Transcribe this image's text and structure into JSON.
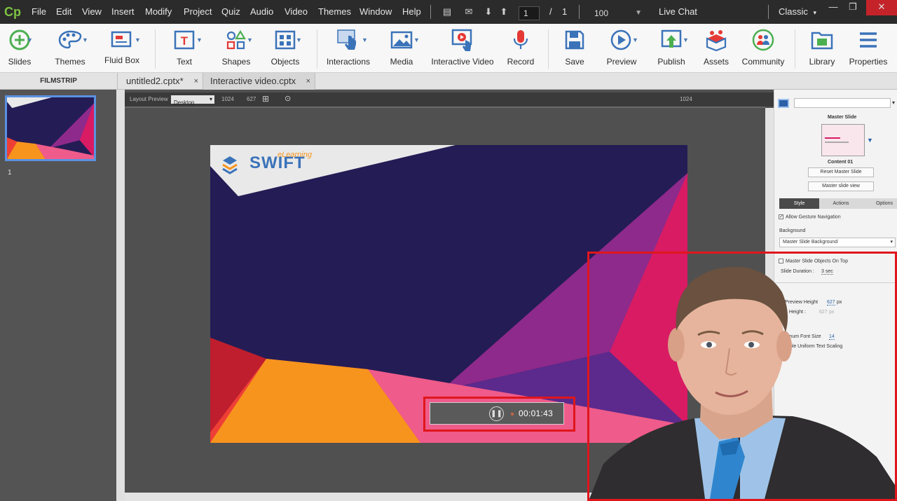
{
  "app": {
    "logo": "Cp",
    "mode": "Classic",
    "live_chat": "Live Chat"
  },
  "menu": [
    "File",
    "Edit",
    "View",
    "Insert",
    "Modify",
    "Project",
    "Quiz",
    "Audio",
    "Video",
    "Themes",
    "Window",
    "Help"
  ],
  "nav": {
    "slide_current": "1",
    "slide_separator": "/",
    "slide_total": "1",
    "zoom": "100"
  },
  "toolbar": {
    "slides": "Slides",
    "themes": "Themes",
    "fluid_box": "Fluid Box",
    "text": "Text",
    "shapes": "Shapes",
    "objects": "Objects",
    "interactions": "Interactions",
    "media": "Media",
    "interactive_video": "Interactive Video",
    "record": "Record",
    "save": "Save",
    "preview": "Preview",
    "publish": "Publish",
    "assets": "Assets",
    "community": "Community",
    "library": "Library",
    "properties": "Properties"
  },
  "tabs": {
    "filmstrip_title": "FILMSTRIP",
    "documents": [
      {
        "label": "untitled2.cptx*",
        "close": "×"
      },
      {
        "label": "Interactive video.cptx",
        "close": "×"
      }
    ]
  },
  "filmstrip": {
    "slide_number": "1"
  },
  "stage": {
    "layout_preview": "Layout Preview",
    "device": "Desktop",
    "width": "1024",
    "height": "627",
    "ruler_end": "1024"
  },
  "slide": {
    "brand_script": "eLearning",
    "brand_name": "SWIFT",
    "timer": "00:01:43",
    "colors": {
      "navy": "#241c55",
      "purple": "#8e2a8b",
      "magenta": "#d81b63",
      "orange": "#f7941d",
      "red": "#ee3f36",
      "pink": "#ef5b8a"
    }
  },
  "properties": {
    "master_slide_title": "Master Slide",
    "master_name": "Content 01",
    "reset_master": "Reset Master Slide",
    "master_view": "Master slide view",
    "tabs": [
      "Style",
      "Actions",
      "Options"
    ],
    "allow_gesture": "Allow Gesture Navigation",
    "background_label": "Background",
    "background_value": "Master Slide Background",
    "objects_on_top": "Master Slide Objects On Top",
    "slide_duration_label": "Slide Duration :",
    "slide_duration_value": "3 sec",
    "preview_height_label": "Preview Height",
    "preview_height_value": "627",
    "preview_height_unit": "px",
    "height_label": "n Height :",
    "height_value": "627",
    "height_unit": "px",
    "min_font_label": "imum Font Size",
    "min_font_value": "14",
    "uniform_label": "able Uniform Text Scaling"
  }
}
